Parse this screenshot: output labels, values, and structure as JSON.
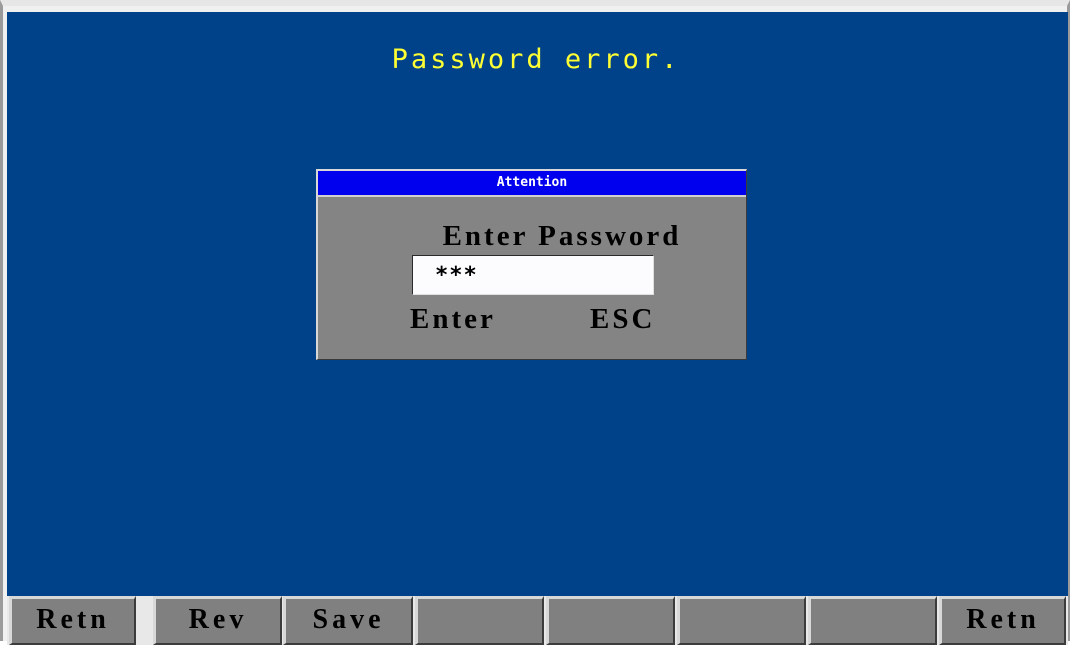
{
  "status_message": "Password error.",
  "dialog": {
    "title": "Attention",
    "prompt": "Enter Password",
    "password_value": "***",
    "enter_label": "Enter",
    "esc_label": "ESC"
  },
  "function_keys": [
    {
      "label": "Retn"
    },
    {
      "label": "Rev"
    },
    {
      "label": "Save"
    },
    {
      "label": ""
    },
    {
      "label": ""
    },
    {
      "label": ""
    },
    {
      "label": ""
    },
    {
      "label": "Retn"
    }
  ],
  "colors": {
    "background": "#00428a",
    "status_text": "#ffff33",
    "dialog_title_bar": "#0000ee",
    "dialog_body": "#848484",
    "function_key": "#808080"
  }
}
